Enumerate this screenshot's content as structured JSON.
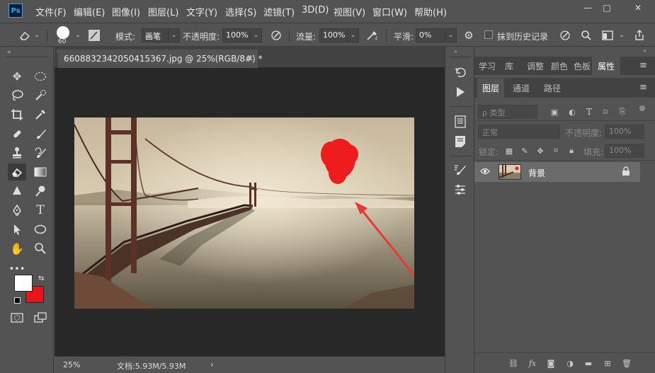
{
  "menubar": {
    "app_logo": "Ps",
    "items": [
      "文件(F)",
      "编辑(E)",
      "图像(I)",
      "图层(L)",
      "文字(Y)",
      "选择(S)",
      "滤镜(T)",
      "3D(D)",
      "视图(V)",
      "窗口(W)",
      "帮助(H)"
    ],
    "win_min": "—",
    "win_max": "□",
    "win_close": "✕"
  },
  "options": {
    "brush_size": "60",
    "mode_label": "模式:",
    "mode_value": "画笔",
    "opacity_label": "不透明度:",
    "opacity_value": "100%",
    "flow_label": "流量:",
    "flow_value": "100%",
    "smooth_label": "平滑:",
    "smooth_value": "0%",
    "history_label": "抹到历史记录"
  },
  "document": {
    "tab_title": "6608832342050415367.jpg @ 25%(RGB/8#) *",
    "tab_close": "×",
    "zoom": "25%",
    "doc_info": "文档:5.93M/5.93M",
    "status_arrow": "›"
  },
  "panel": {
    "top_tabs": [
      "学习",
      "库",
      "调整",
      "颜色",
      "色板",
      "属性"
    ],
    "active_top_tab": "属性",
    "layer_tabs": [
      "图层",
      "通道",
      "路径"
    ],
    "filter_label": "ρ 类型",
    "blend_mode": "正常",
    "opacity_label": "不透明度:",
    "opacity_value": "100%",
    "lock_label": "锁定:",
    "fill_label": "填充:",
    "fill_value": "100%",
    "layer_name": "背景"
  },
  "colors": {
    "foreground": "#ffffff",
    "background": "#e8141a",
    "accent_blue": "#31a8ff",
    "annotation_red": "#ee1c1c"
  }
}
